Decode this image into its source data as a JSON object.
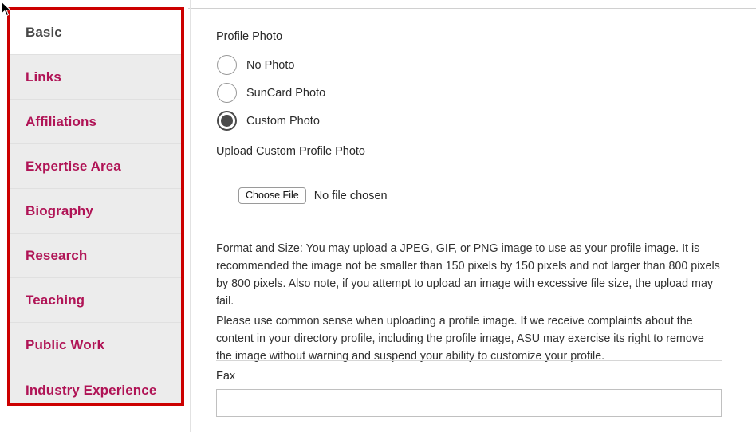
{
  "sidebar": {
    "items": [
      {
        "label": "Basic",
        "active": true
      },
      {
        "label": "Links",
        "active": false
      },
      {
        "label": "Affiliations",
        "active": false
      },
      {
        "label": "Expertise Area",
        "active": false
      },
      {
        "label": "Biography",
        "active": false
      },
      {
        "label": "Research",
        "active": false
      },
      {
        "label": "Teaching",
        "active": false
      },
      {
        "label": "Public Work",
        "active": false
      },
      {
        "label": "Industry Experience",
        "active": false
      }
    ],
    "highlight_color": "#cc0000",
    "link_color": "#b01456",
    "active_label_color": "#484848",
    "item_background": "#ececec",
    "active_background": "#ffffff"
  },
  "main": {
    "profile_photo_label": "Profile Photo",
    "photo_options": [
      {
        "label": "No Photo",
        "selected": false
      },
      {
        "label": "SunCard Photo",
        "selected": false
      },
      {
        "label": "Custom Photo",
        "selected": true
      }
    ],
    "upload_label": "Upload Custom Profile Photo",
    "choose_file_button": "Choose File",
    "file_status": "No file chosen",
    "help_text_1": "Format and Size: You may upload a JPEG, GIF, or PNG image to use as your profile image. It is recommended the image not be smaller than 150 pixels by 150 pixels and not larger than 800 pixels by 800 pixels. Also note, if you attempt to upload an image with excessive file size, the upload may fail.",
    "help_text_2": "Please use common sense when uploading a profile image. If we receive complaints about the content in your directory profile, including the profile image, ASU may exercise its right to remove the image without warning and suspend your ability to customize your profile.",
    "fax_label": "Fax",
    "fax_value": "",
    "fax_placeholder": ""
  }
}
